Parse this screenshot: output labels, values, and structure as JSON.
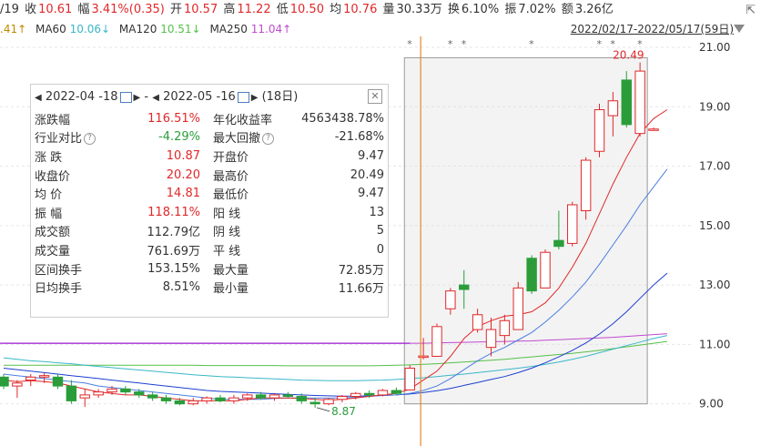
{
  "top": {
    "date_fragment": "/19",
    "close_label": "收",
    "close": "10.61",
    "change_label": "幅",
    "change": "3.41%(0.35)",
    "open_label": "开",
    "open": "10.57",
    "high_label": "高",
    "high": "11.22",
    "low_label": "低",
    "low": "10.50",
    "avg_label": "均",
    "avg": "10.76",
    "vol_label": "量",
    "vol": "30.33万",
    "turn_label": "换",
    "turn": "6.10%",
    "amp_label": "振",
    "amp": "7.02%",
    "amt_label": "额",
    "amt": "3.26亿"
  },
  "ma": {
    "ma_first_value": ".41↑",
    "ma60_label": "MA60",
    "ma60": "10.06↓",
    "ma120_label": "MA120",
    "ma120": "10.51↓",
    "ma250_label": "MA250",
    "ma250": "11.04↑"
  },
  "range_text": "2022/02/17-2022/05/17(59日)",
  "stats": {
    "header": {
      "start_date": "2022-04 -18",
      "sep": "-",
      "end_date": "2022-05 -16",
      "days": "(18日)"
    },
    "rows": [
      {
        "k": "涨跌幅",
        "v": "116.51%",
        "k2": "年化收益率",
        "v2": "4563438.78%"
      },
      {
        "k": "行业对比",
        "v": "-4.29%",
        "k2": "最大回撤",
        "v2": "-21.68%"
      },
      {
        "k": "涨  跌",
        "v": "10.87",
        "k2": "开盘价",
        "v2": "9.47"
      },
      {
        "k": "收盘价",
        "v": "20.20",
        "k2": "最高价",
        "v2": "20.49"
      },
      {
        "k": "均  价",
        "v": "14.81",
        "k2": "最低价",
        "v2": "9.47"
      },
      {
        "k": "振  幅",
        "v": "118.11%",
        "k2": "阳  线",
        "v2": "13"
      },
      {
        "k": "成交额",
        "v": "112.79亿",
        "k2": "阴  线",
        "v2": "5"
      },
      {
        "k": "成交量",
        "v": "761.69万",
        "k2": "平  线",
        "v2": "0"
      },
      {
        "k": "区间换手",
        "v": "153.15%",
        "k2": "最大量",
        "v2": "72.85万"
      },
      {
        "k": "日均换手",
        "v": "8.51%",
        "k2": "最小量",
        "v2": "11.66万"
      }
    ]
  },
  "colors": {
    "up": "#e0282a",
    "down": "#2a9d3a",
    "ma5": "#e0282a",
    "ma10": "#4a7fe0",
    "ma20": "#1c3fd0",
    "ma60": "#3ab7c8",
    "ma120": "#55c04a",
    "ma250": "#c04ad0",
    "purple_line": "#a020d0"
  },
  "chart_data": {
    "type": "candlestick",
    "y_ticks": [
      "21.00",
      "19.00",
      "17.00",
      "15.00",
      "13.00",
      "11.00",
      "9.00"
    ],
    "ylim": [
      8.5,
      21.0
    ],
    "annotations": {
      "high_label": "20.49",
      "low_label": "8.87"
    },
    "candles": [
      {
        "o": 9.9,
        "h": 10.0,
        "l": 9.5,
        "c": 9.6
      },
      {
        "o": 9.6,
        "h": 9.8,
        "l": 9.2,
        "c": 9.7
      },
      {
        "o": 9.8,
        "h": 10.0,
        "l": 9.6,
        "c": 9.9
      },
      {
        "o": 9.9,
        "h": 10.05,
        "l": 9.7,
        "c": 9.95
      },
      {
        "o": 9.9,
        "h": 10.0,
        "l": 9.5,
        "c": 9.6
      },
      {
        "o": 9.6,
        "h": 9.8,
        "l": 9.0,
        "c": 9.1
      },
      {
        "o": 9.2,
        "h": 9.5,
        "l": 8.9,
        "c": 9.3
      },
      {
        "o": 9.3,
        "h": 9.5,
        "l": 9.2,
        "c": 9.4
      },
      {
        "o": 9.4,
        "h": 9.6,
        "l": 9.3,
        "c": 9.5
      },
      {
        "o": 9.5,
        "h": 9.6,
        "l": 9.3,
        "c": 9.4
      },
      {
        "o": 9.4,
        "h": 9.5,
        "l": 9.2,
        "c": 9.3
      },
      {
        "o": 9.3,
        "h": 9.4,
        "l": 9.1,
        "c": 9.2
      },
      {
        "o": 9.2,
        "h": 9.3,
        "l": 9.0,
        "c": 9.1
      },
      {
        "o": 9.1,
        "h": 9.2,
        "l": 8.95,
        "c": 9.0
      },
      {
        "o": 9.0,
        "h": 9.2,
        "l": 8.95,
        "c": 9.1
      },
      {
        "o": 9.1,
        "h": 9.25,
        "l": 9.0,
        "c": 9.2
      },
      {
        "o": 9.2,
        "h": 9.3,
        "l": 9.05,
        "c": 9.1
      },
      {
        "o": 9.1,
        "h": 9.3,
        "l": 9.0,
        "c": 9.2
      },
      {
        "o": 9.2,
        "h": 9.35,
        "l": 9.1,
        "c": 9.3
      },
      {
        "o": 9.3,
        "h": 9.4,
        "l": 9.15,
        "c": 9.2
      },
      {
        "o": 9.2,
        "h": 9.35,
        "l": 9.1,
        "c": 9.3
      },
      {
        "o": 9.3,
        "h": 9.4,
        "l": 9.2,
        "c": 9.25
      },
      {
        "o": 9.25,
        "h": 9.35,
        "l": 9.0,
        "c": 9.1
      },
      {
        "o": 9.05,
        "h": 9.2,
        "l": 8.87,
        "c": 9.0
      },
      {
        "o": 9.0,
        "h": 9.2,
        "l": 8.95,
        "c": 9.15
      },
      {
        "o": 9.15,
        "h": 9.3,
        "l": 9.05,
        "c": 9.25
      },
      {
        "o": 9.25,
        "h": 9.4,
        "l": 9.15,
        "c": 9.35
      },
      {
        "o": 9.35,
        "h": 9.45,
        "l": 9.2,
        "c": 9.3
      },
      {
        "o": 9.3,
        "h": 9.5,
        "l": 9.25,
        "c": 9.45
      },
      {
        "o": 9.45,
        "h": 9.55,
        "l": 9.3,
        "c": 9.35
      },
      {
        "o": 9.47,
        "h": 10.3,
        "l": 9.47,
        "c": 10.2
      },
      {
        "o": 10.6,
        "h": 11.22,
        "l": 10.5,
        "c": 10.61
      },
      {
        "o": 10.6,
        "h": 11.7,
        "l": 10.6,
        "c": 11.6
      },
      {
        "o": 12.2,
        "h": 12.9,
        "l": 12.0,
        "c": 12.8
      },
      {
        "o": 13.0,
        "h": 13.5,
        "l": 12.2,
        "c": 12.85
      },
      {
        "o": 11.5,
        "h": 12.2,
        "l": 11.4,
        "c": 12.0
      },
      {
        "o": 10.9,
        "h": 11.9,
        "l": 10.6,
        "c": 11.5
      },
      {
        "o": 11.3,
        "h": 12.0,
        "l": 11.0,
        "c": 11.8
      },
      {
        "o": 11.5,
        "h": 13.1,
        "l": 11.5,
        "c": 12.9
      },
      {
        "o": 13.9,
        "h": 14.0,
        "l": 12.7,
        "c": 12.8
      },
      {
        "o": 12.9,
        "h": 14.2,
        "l": 12.9,
        "c": 14.1
      },
      {
        "o": 14.5,
        "h": 15.5,
        "l": 14.2,
        "c": 14.3
      },
      {
        "o": 14.4,
        "h": 15.8,
        "l": 14.3,
        "c": 15.7
      },
      {
        "o": 15.5,
        "h": 17.3,
        "l": 15.2,
        "c": 17.2
      },
      {
        "o": 17.5,
        "h": 19.1,
        "l": 17.3,
        "c": 18.9
      },
      {
        "o": 18.7,
        "h": 19.5,
        "l": 18.0,
        "c": 19.2
      },
      {
        "o": 19.9,
        "h": 20.2,
        "l": 18.3,
        "c": 18.4
      },
      {
        "o": 18.1,
        "h": 20.49,
        "l": 18.0,
        "c": 20.2
      },
      {
        "o": 18.25,
        "h": 18.3,
        "l": 18.2,
        "c": 18.25
      }
    ],
    "ma5": [
      9.8,
      9.75,
      9.78,
      9.75,
      9.7,
      9.6,
      9.5,
      9.4,
      9.35,
      9.3,
      9.3,
      9.25,
      9.2,
      9.15,
      9.1,
      9.1,
      9.1,
      9.1,
      9.15,
      9.2,
      9.2,
      9.2,
      9.18,
      9.15,
      9.12,
      9.15,
      9.2,
      9.25,
      9.3,
      9.35,
      9.5,
      9.8,
      10.1,
      10.6,
      11.2,
      11.6,
      11.8,
      11.95,
      12.0,
      12.1,
      12.4,
      12.9,
      13.6,
      14.4,
      15.4,
      16.4,
      17.3,
      18.1,
      18.6,
      18.9
    ],
    "ma10": [
      10.0,
      9.95,
      9.9,
      9.85,
      9.8,
      9.75,
      9.7,
      9.6,
      9.55,
      9.5,
      9.45,
      9.4,
      9.35,
      9.3,
      9.25,
      9.2,
      9.15,
      9.15,
      9.15,
      9.15,
      9.18,
      9.2,
      9.2,
      9.2,
      9.2,
      9.2,
      9.22,
      9.25,
      9.28,
      9.3,
      9.35,
      9.45,
      9.6,
      9.85,
      10.15,
      10.45,
      10.7,
      10.9,
      11.15,
      11.4,
      11.75,
      12.15,
      12.6,
      13.1,
      13.7,
      14.35,
      15.0,
      15.7,
      16.3,
      16.9
    ],
    "ma20": [
      10.2,
      10.15,
      10.1,
      10.05,
      10.0,
      9.95,
      9.9,
      9.85,
      9.8,
      9.75,
      9.7,
      9.65,
      9.6,
      9.55,
      9.5,
      9.45,
      9.42,
      9.4,
      9.38,
      9.36,
      9.34,
      9.32,
      9.3,
      9.28,
      9.27,
      9.26,
      9.26,
      9.27,
      9.28,
      9.3,
      9.33,
      9.38,
      9.44,
      9.52,
      9.62,
      9.72,
      9.82,
      9.92,
      10.05,
      10.2,
      10.38,
      10.58,
      10.8,
      11.05,
      11.35,
      11.7,
      12.1,
      12.55,
      13.0,
      13.4
    ],
    "ma60": [
      10.55,
      10.5,
      10.45,
      10.42,
      10.38,
      10.35,
      10.3,
      10.26,
      10.22,
      10.18,
      10.14,
      10.1,
      10.06,
      10.02,
      9.98,
      9.95,
      9.92,
      9.9,
      9.88,
      9.86,
      9.84,
      9.82,
      9.8,
      9.79,
      9.78,
      9.78,
      9.78,
      9.79,
      9.8,
      9.82,
      9.85,
      9.88,
      9.92,
      9.96,
      10.0,
      10.05,
      10.1,
      10.15,
      10.2,
      10.26,
      10.33,
      10.41,
      10.5,
      10.6,
      10.72,
      10.84,
      10.96,
      11.08,
      11.2,
      11.3
    ],
    "ma120": [
      10.3,
      10.3,
      10.3,
      10.3,
      10.3,
      10.3,
      10.3,
      10.3,
      10.3,
      10.3,
      10.3,
      10.3,
      10.3,
      10.3,
      10.3,
      10.29,
      10.29,
      10.29,
      10.29,
      10.29,
      10.29,
      10.28,
      10.28,
      10.28,
      10.28,
      10.28,
      10.28,
      10.28,
      10.29,
      10.3,
      10.31,
      10.33,
      10.35,
      10.38,
      10.41,
      10.44,
      10.47,
      10.5,
      10.54,
      10.58,
      10.62,
      10.66,
      10.7,
      10.75,
      10.8,
      10.86,
      10.92,
      10.98,
      11.04,
      11.1
    ],
    "ma250": [
      11.04,
      11.04,
      11.04,
      11.04,
      11.04,
      11.04,
      11.04,
      11.04,
      11.04,
      11.04,
      11.04,
      11.04,
      11.04,
      11.04,
      11.04,
      11.04,
      11.04,
      11.04,
      11.04,
      11.04,
      11.04,
      11.04,
      11.04,
      11.04,
      11.04,
      11.04,
      11.04,
      11.04,
      11.04,
      11.04,
      11.04,
      11.04,
      11.05,
      11.06,
      11.07,
      11.08,
      11.09,
      11.1,
      11.11,
      11.12,
      11.14,
      11.16,
      11.18,
      11.2,
      11.22,
      11.24,
      11.27,
      11.3,
      11.33,
      11.36
    ],
    "selection": {
      "start_index": 30,
      "end_index": 47
    },
    "star_indices": [
      30,
      33,
      34,
      39,
      44,
      45,
      47
    ],
    "cursor_index": 31
  }
}
